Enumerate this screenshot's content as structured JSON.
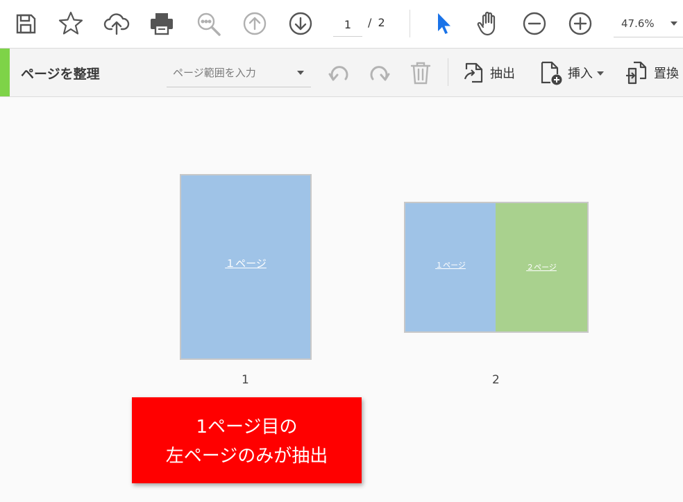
{
  "toolbar": {
    "icons": [
      "save-icon",
      "bookmark-star-icon",
      "cloud-upload-icon",
      "print-icon",
      "zoom-search-icon",
      "page-up-icon",
      "page-down-icon",
      "select-pointer-icon",
      "hand-tool-icon",
      "zoom-out-icon",
      "zoom-in-icon"
    ],
    "current_page": "1",
    "page_total": "/ 2",
    "zoom": "47.6%"
  },
  "organize": {
    "title": "ページを整理",
    "range_placeholder": "ページ範囲を入力",
    "actions": {
      "extract": "抽出",
      "insert": "挿入",
      "replace": "置換"
    },
    "accent_color": "#7ed348"
  },
  "thumbnails": [
    {
      "number": "1",
      "labels": [
        "１ページ"
      ]
    },
    {
      "number": "2",
      "labels": [
        "１ページ",
        "２ページ"
      ]
    }
  ],
  "colors": {
    "page_blue": "#9fc3e7",
    "page_green": "#a9d18e",
    "callout_red": "#ff0000",
    "pointer_blue": "#1a73e8"
  },
  "callout": {
    "line1": "1ページ目の",
    "line2": "左ページのみが抽出"
  }
}
